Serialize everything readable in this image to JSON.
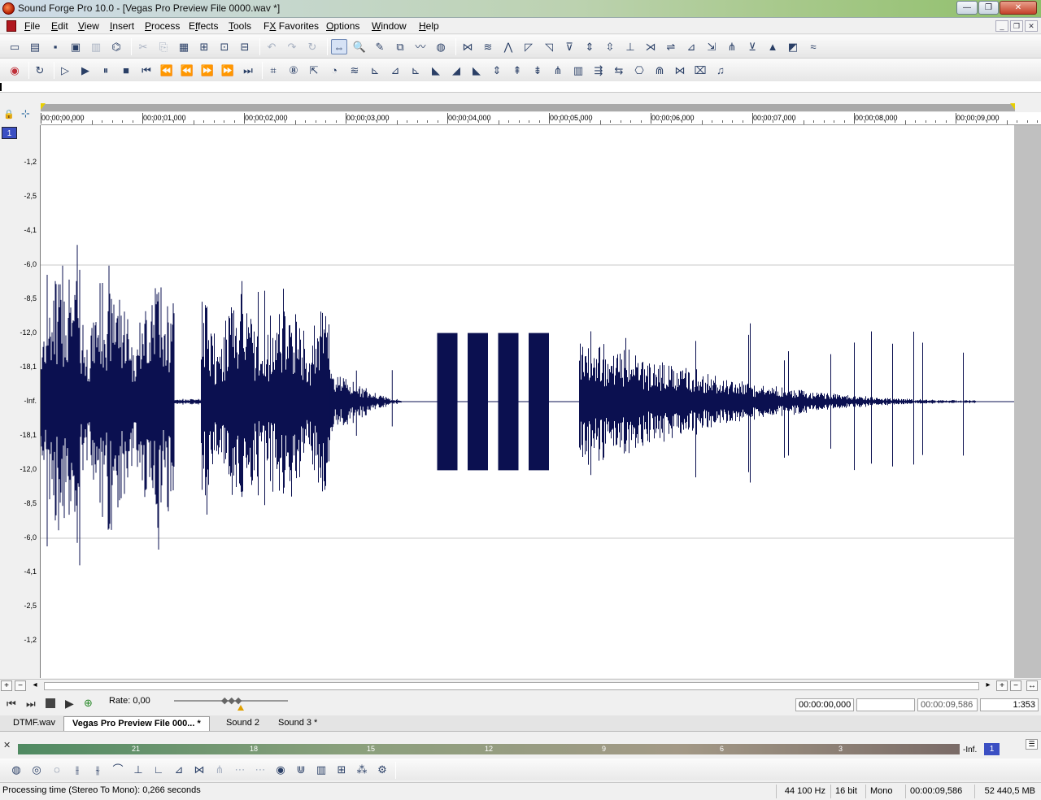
{
  "window": {
    "title": "Sound Forge Pro 10.0 - [Vegas Pro Preview File 0000.wav *]",
    "minimize": "—",
    "restore": "❐",
    "close": "✕"
  },
  "menu": [
    "File",
    "Edit",
    "View",
    "Insert",
    "Process",
    "Effects",
    "Tools",
    "FX Favorites",
    "Options",
    "Window",
    "Help"
  ],
  "menu_accel": [
    "F",
    "E",
    "V",
    "I",
    "P",
    "f",
    "T",
    "X",
    "O",
    "W",
    "H"
  ],
  "mdi": {
    "minimize": "_",
    "restore": "❐",
    "close": "✕"
  },
  "toolbar1": [
    "new-icon",
    "open-icon",
    "save-icon",
    "save-as-icon",
    "save-all-icon",
    "render-icon",
    "cut-icon",
    "copy-icon",
    "paste-icon",
    "mix-icon",
    "crop-icon",
    "trim-icon",
    "undo-icon",
    "redo-icon",
    "repeat-icon",
    "edit-tool-icon",
    "magnify-tool-icon",
    "pencil-tool-icon",
    "event-tool-icon",
    "envelope-tool-icon",
    "ear-icon",
    "bit-meter-icon",
    "dc-offset-icon",
    "fade-in-icon",
    "fade-out-icon",
    "insert-silence-icon",
    "invert-icon",
    "mute-icon",
    "normalize-icon",
    "pan-icon",
    "resample-icon",
    "reverse-icon",
    "smooth-icon",
    "time-stretch-icon",
    "volume-icon",
    "graphic-eq-icon",
    "spectrum-icon",
    "statistics-icon",
    "auto-trim-icon"
  ],
  "toolbar1_glyphs": [
    "▭",
    "▤",
    "▪",
    "▣",
    "▥",
    "⌬",
    "✂",
    "⎘",
    "▦",
    "⊞",
    "⊡",
    "⊟",
    "↶",
    "↷",
    "↻",
    "⇔",
    "🔍",
    "✎",
    "⧉",
    "〰",
    "◍",
    "⋈",
    "≋",
    "⋀",
    "◸",
    "◹",
    "⊽",
    "⇕",
    "⇳",
    "⊥",
    "⋊",
    "⇌",
    "⊿",
    "⇲",
    "⋔",
    "⊻",
    "▲",
    "◩",
    "≈"
  ],
  "toolbar2_glyphs": [
    "◉",
    "↻",
    "▷",
    "▶",
    "⏸",
    "■",
    "⏮",
    "⏪",
    "⏪",
    "⏩",
    "⏩",
    "⏭",
    "⌗",
    "⑧",
    "⇱",
    "◔",
    "≋",
    "⊾",
    "⊿",
    "⊾",
    "◣",
    "◢",
    "◣",
    "⇕",
    "⇞",
    "⇟",
    "⋔",
    "▥",
    "⇶",
    "⇆",
    "⎔",
    "⋒",
    "⋈",
    "⌧",
    "♫"
  ],
  "ruler": {
    "ticks": [
      "00:00:00,000",
      "00:00:01,000",
      "00:00:02,000",
      "00:00:03,000",
      "00:00:04,000",
      "00:00:05,000",
      "00:00:06,000",
      "00:00:07,000",
      "00:00:08,000",
      "00:00:09,000"
    ]
  },
  "channel": "1",
  "yaxis": {
    "labels": [
      "-1,2",
      "-2,5",
      "-4,1",
      "-6,0",
      "-8,5",
      "-12,0",
      "-18,1",
      "-Inf.",
      "-18,1",
      "-12,0",
      "-8,5",
      "-6,0",
      "-4,1",
      "-2,5",
      "-1,2"
    ]
  },
  "waveform": {
    "color": "#0b1050",
    "duration_s": 9.586,
    "segments": [
      {
        "type": "speech",
        "start": 0.0,
        "end": 1.32,
        "peak_db": -4.1
      },
      {
        "type": "noise",
        "start": 1.32,
        "end": 1.58,
        "peak_db": -30
      },
      {
        "type": "speech",
        "start": 1.58,
        "end": 2.85,
        "peak_db": -6.0
      },
      {
        "type": "decay",
        "start": 2.85,
        "end": 3.55,
        "peak_db": -18.1
      },
      {
        "type": "tone",
        "start": 3.9,
        "end": 4.1,
        "peak_db": -12.0
      },
      {
        "type": "tone",
        "start": 4.2,
        "end": 4.4,
        "peak_db": -12.0
      },
      {
        "type": "tone",
        "start": 4.5,
        "end": 4.7,
        "peak_db": -12.0
      },
      {
        "type": "tone",
        "start": 4.8,
        "end": 5.0,
        "peak_db": -12.0
      },
      {
        "type": "speech",
        "start": 5.3,
        "end": 9.2,
        "peak_db": -12.0
      }
    ]
  },
  "transport": {
    "rate_label": "Rate: 0,00",
    "position": "00:00:00,000",
    "selection": "",
    "length": "00:00:09,586",
    "zoom": "1:353"
  },
  "tabs": [
    "DTMF.wav",
    "Vegas Pro Preview File 000... *",
    "Sound 2",
    "Sound 3 *"
  ],
  "meter": {
    "labels": [
      "21",
      "18",
      "15",
      "12",
      "9",
      "6",
      "3"
    ],
    "inf_label": "-Inf.",
    "channel": "1"
  },
  "bottom_toolbar_glyphs": [
    "◍",
    "◎",
    "◌",
    "⫲",
    "⫳",
    "⌒",
    "⊥",
    "∟",
    "⊿",
    "⋈",
    "⋔",
    "⋯",
    "⋯",
    "◉",
    "⋓",
    "▥",
    "⊞",
    "⁂",
    "⚙"
  ],
  "status": {
    "message": "Processing time (Stereo To Mono): 0,266 seconds",
    "sample_rate": "44 100 Hz",
    "bit_depth": "16 bit",
    "channels": "Mono",
    "length": "00:00:09,586",
    "free_space": "52 440,5 MB"
  }
}
